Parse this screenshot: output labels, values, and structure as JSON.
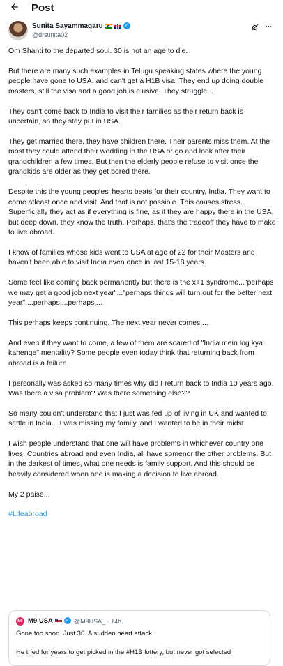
{
  "header": {
    "title": "Post",
    "back_icon": "arrow-left-icon"
  },
  "author": {
    "name": "Sunita Sayammagaru",
    "handle": "@drsunita02",
    "flags": [
      "india-flag",
      "uk-flag"
    ],
    "verified": true,
    "verified_color": "#1d9bf0"
  },
  "post": {
    "paragraphs": [
      "Om Shanti to the departed soul. 30 is not an age to die.",
      "But there are many such examples in Telugu speaking states where the young people have gone to USA, and can't get a H1B visa. They end up doing double masters, still the visa and a good job is elusive. They struggle...",
      "They can't come back to India to visit their families as their return back is uncertain, so they stay put in USA.",
      "They get married there, they have children there. Their parents miss them. At the most they could attend their wedding in the USA or go and look after their grandchildren a few times. But then the elderly people refuse to visit once the grandkids are older as they get bored there.",
      "Despite this the young peoples' hearts beats for their country, India. They want to come atleast once and visit. And that is not possible. This causes stress. Superficially they act as if everything is fine, as if they are happy there in the USA, but deep down, they know the truth. Perhaps, that's the tradeoff they have to make to live abroad.",
      "I know of families whose kids went to USA at age of 22 for their Masters and haven't been able to visit India even once in last 15-18 years.",
      "Some feel like coming back permanently but there is the x+1 syndrome...\"perhaps we may get a good job next year\"...\"perhaps things will turn out for the better next year\"....perhaps....perhaps....",
      "This perhaps keeps continuing. The next year never comes....",
      "And even if they want to come, a few of them are scared of \"India mein log kya kahenge\" mentality? Some people even today think that returning back from abroad is a failure.",
      "I personally was asked so many times why did I return back to India 10 years ago. Was there a visa problem? Was there something else??",
      "So many couldn't understand that I just was fed up of living in UK and wanted to settle in India....I was missing my family, and I wanted to be in their midst.",
      "I wish people understand that one will have problems in whichever country one lives. Countries abroad and even India, all have somenor the other problems. But in the darkest of times, what one needs is family support. And this should be heavily considered when one is making a decision to live abroad.",
      "My 2 paise..."
    ],
    "hashtag": "#Lifeabroad",
    "link_color": "#1d9bf0"
  },
  "quote": {
    "avatar_text": "M9",
    "name": "M9 USA",
    "flag": "us-flag",
    "verified": true,
    "handle": "@M9USA_",
    "time": "14h",
    "text": "Gone too soon. Just 30. A sudden heart attack.",
    "text_cutoff": "He tried for years to get picked in the #H1B lottery, but never got selected"
  }
}
